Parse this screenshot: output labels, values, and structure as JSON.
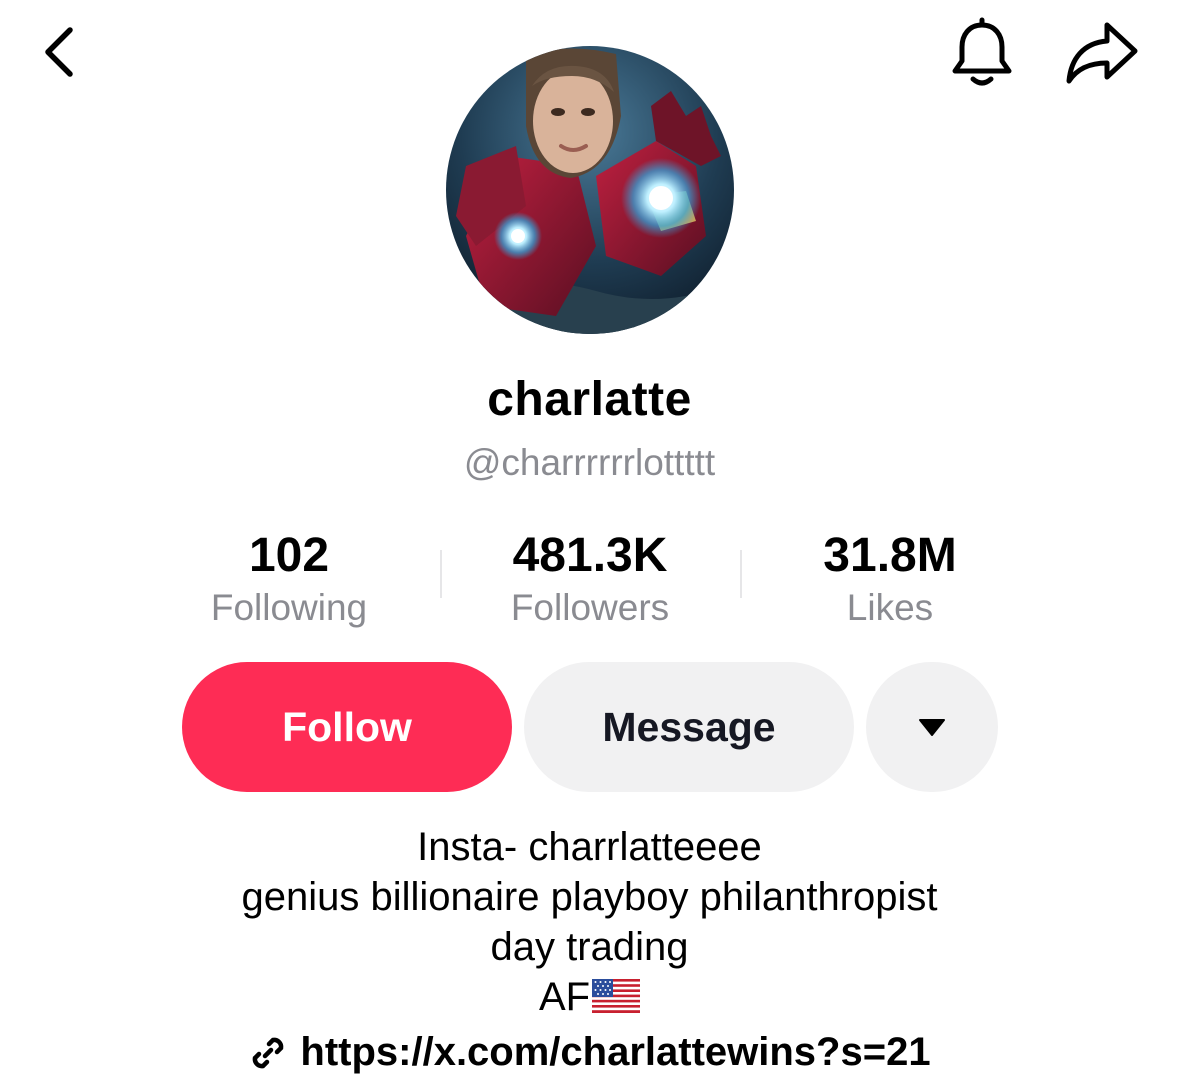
{
  "header": {
    "back_icon": "chevron-left-icon",
    "bell_icon": "bell-icon",
    "share_icon": "share-arrow-icon"
  },
  "profile": {
    "display_name": "charlatte",
    "handle": "@charrrrrrlottttt",
    "avatar": "avatar-photo"
  },
  "stats": [
    {
      "value": "102",
      "label": "Following"
    },
    {
      "value": "481.3K",
      "label": "Followers"
    },
    {
      "value": "31.8M",
      "label": "Likes"
    }
  ],
  "actions": {
    "follow_label": "Follow",
    "message_label": "Message",
    "more_icon": "caret-down-icon"
  },
  "bio": {
    "lines": [
      "Insta- charrlatteeee",
      "genius billionaire playboy philanthropist",
      "day trading",
      "AF"
    ],
    "flag_icon": "us-flag-icon"
  },
  "link": {
    "icon": "link-icon",
    "url": "https://x.com/charlattewins?s=21"
  },
  "colors": {
    "follow": "#fe2c55",
    "secondary_button": "#f1f1f2",
    "muted_text": "#8a8b91"
  }
}
